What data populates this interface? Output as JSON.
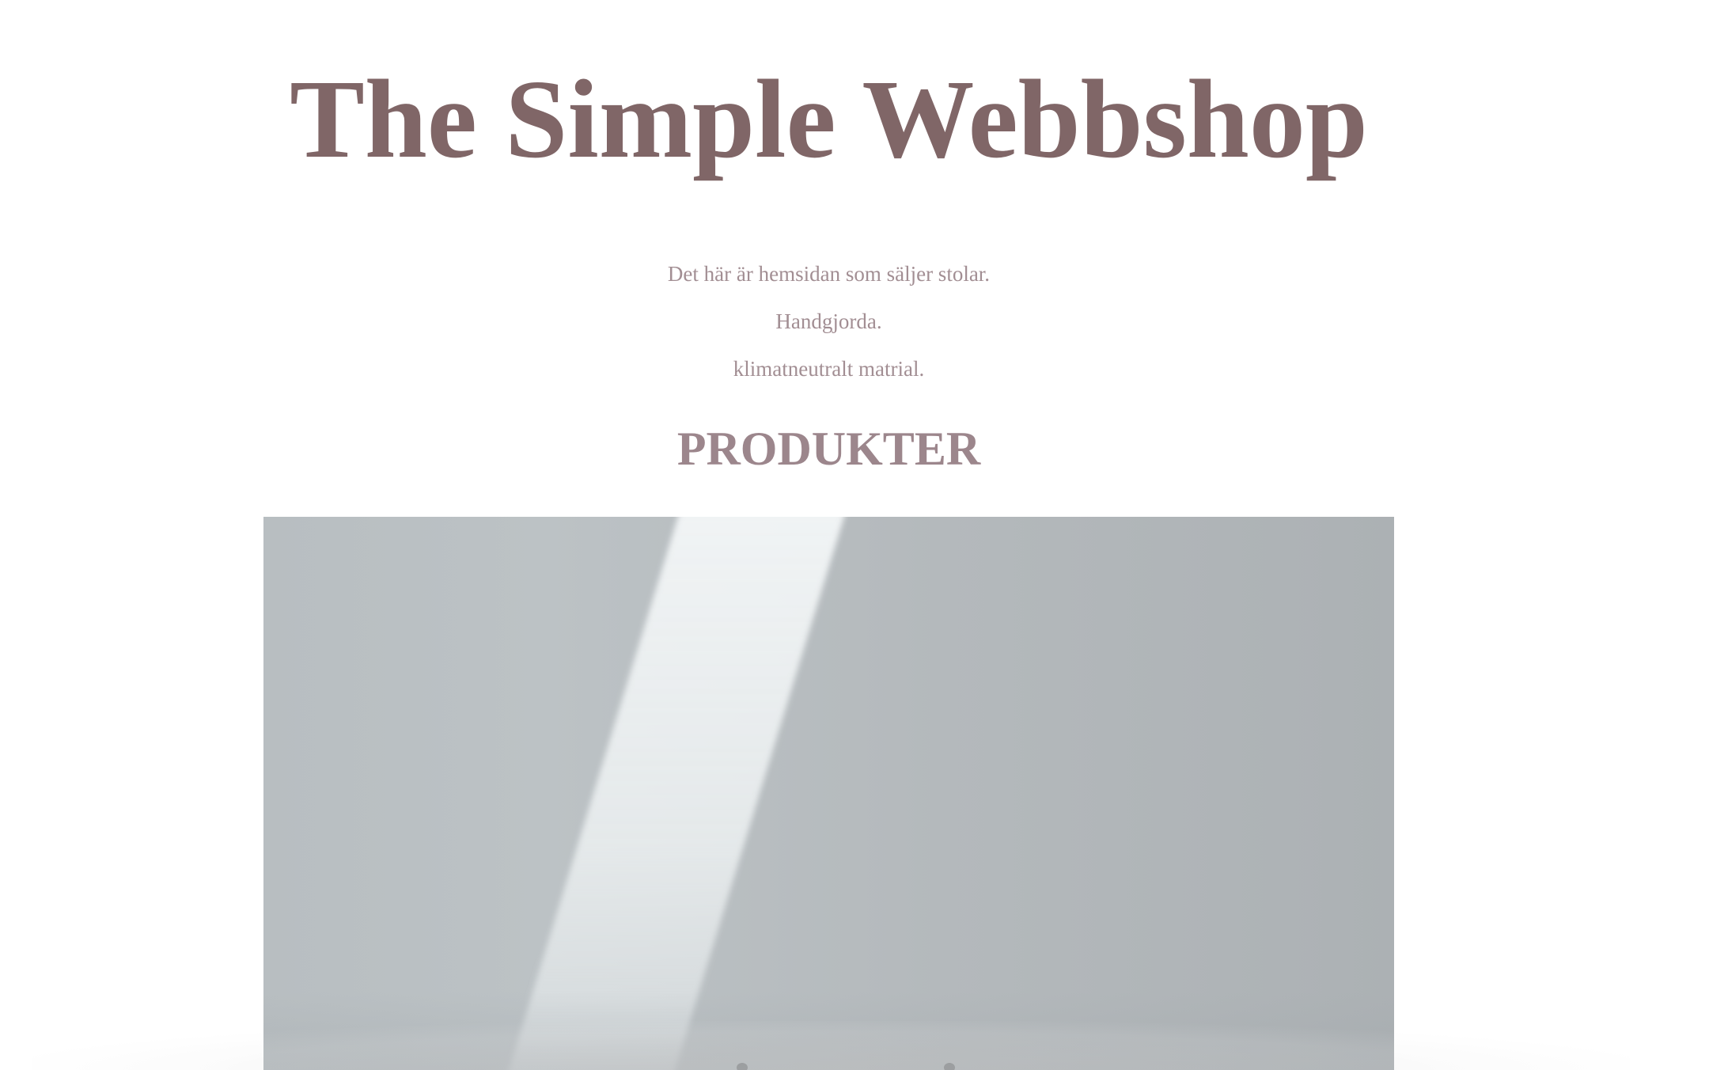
{
  "header": {
    "title": "The Simple Webbshop"
  },
  "intro": {
    "line1": "Det här är hemsidan som säljer stolar.",
    "line2": "Handgjorda.",
    "line3": "klimatneutralt matrial."
  },
  "products": {
    "heading": "PRODUKTER"
  },
  "colors": {
    "title": "#806667",
    "text": "#a28e93",
    "heading": "#9c868c",
    "background": "#ffffff"
  }
}
